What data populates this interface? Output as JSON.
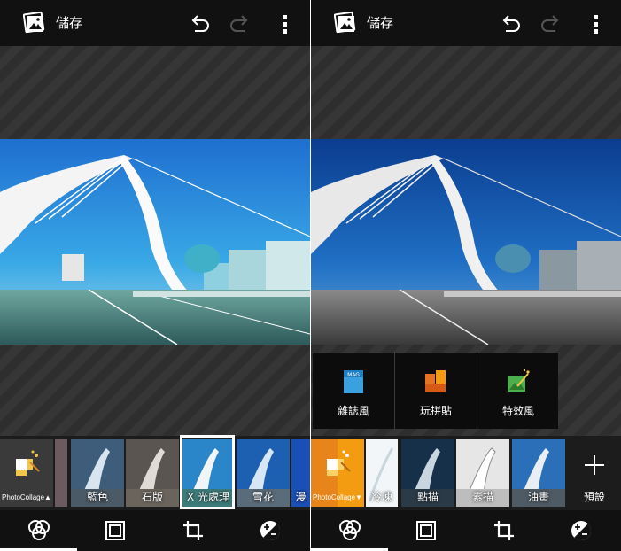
{
  "left_screen": {
    "topbar": {
      "title": "儲存",
      "icons": [
        "gallery-icon",
        "undo-icon",
        "redo-icon",
        "more-vert-icon"
      ]
    },
    "photo": {
      "description_icon": "bridge-photo",
      "effect": "X 光處理"
    },
    "filters": {
      "photocollage": "PhotoCollage▲",
      "items": [
        {
          "label": "藍色"
        },
        {
          "label": "石版"
        },
        {
          "label": "X 光處理",
          "selected": true
        },
        {
          "label": "雪花"
        },
        {
          "label": "漫"
        }
      ]
    },
    "bottom_tabs": [
      {
        "icon": "effects-icon",
        "active": true
      },
      {
        "icon": "frame-icon"
      },
      {
        "icon": "crop-icon"
      },
      {
        "icon": "adjust-icon"
      }
    ]
  },
  "right_screen": {
    "topbar": {
      "title": "儲存",
      "icons": [
        "gallery-icon",
        "undo-icon",
        "redo-icon",
        "more-vert-icon"
      ]
    },
    "popup_menu": [
      {
        "label": "雜誌風",
        "icon": "magazine-icon",
        "icon_text": "MAG"
      },
      {
        "label": "玩拼貼",
        "icon": "collage-icon"
      },
      {
        "label": "特效風",
        "icon": "effect-style-icon"
      }
    ],
    "filters": {
      "photocollage": "PhotoCollage▼",
      "items": [
        {
          "label": "冷凍"
        },
        {
          "label": "點描"
        },
        {
          "label": "素描"
        },
        {
          "label": "油畫"
        }
      ],
      "preset": {
        "label": "預設",
        "icon": "plus-icon"
      }
    },
    "bottom_tabs": [
      {
        "icon": "effects-icon",
        "active": true
      },
      {
        "icon": "frame-icon"
      },
      {
        "icon": "crop-icon"
      },
      {
        "icon": "adjust-icon"
      }
    ]
  },
  "colors": {
    "bar_bg": "#111111",
    "strip_bg": "#1c1c1c",
    "accent_orange": "#f39c12",
    "sky_blue": "#2a7fd4"
  }
}
